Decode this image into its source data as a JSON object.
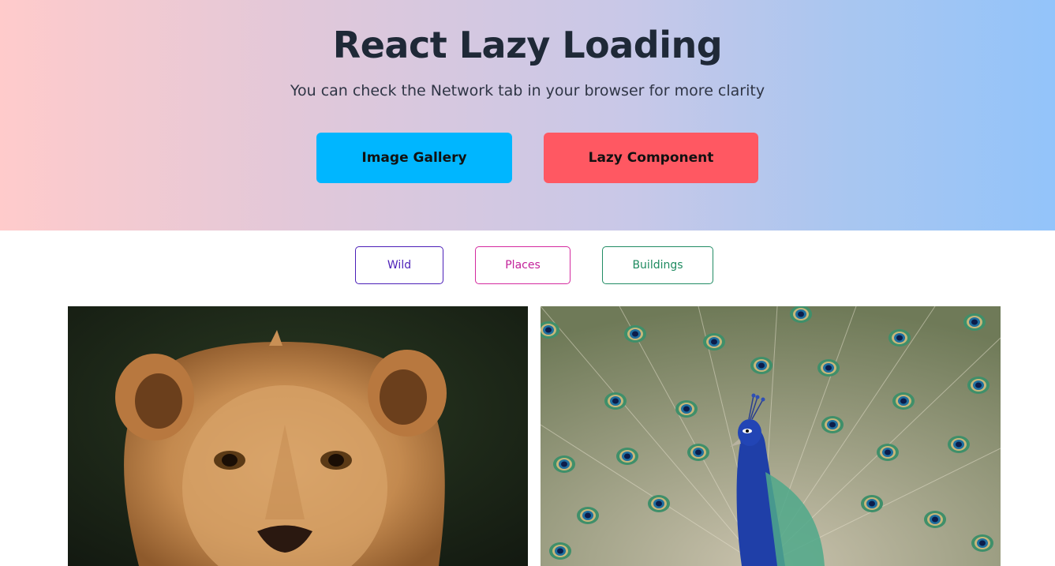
{
  "header": {
    "title": "React Lazy Loading",
    "subtitle": "You can check the Network tab in your browser for more clarity"
  },
  "nav": {
    "gallery_label": "Image Gallery",
    "lazy_label": "Lazy Component"
  },
  "filters": [
    {
      "label": "Wild",
      "color": "#4b1fb8"
    },
    {
      "label": "Places",
      "color": "#c3229a"
    },
    {
      "label": "Buildings",
      "color": "#1e8b60"
    }
  ],
  "gallery": {
    "images": [
      {
        "subject": "lion-photo"
      },
      {
        "subject": "peacock-photo"
      }
    ]
  },
  "colors": {
    "gallery_button": "#00b6ff",
    "lazy_button": "#ff5862",
    "title": "#1f2937"
  }
}
